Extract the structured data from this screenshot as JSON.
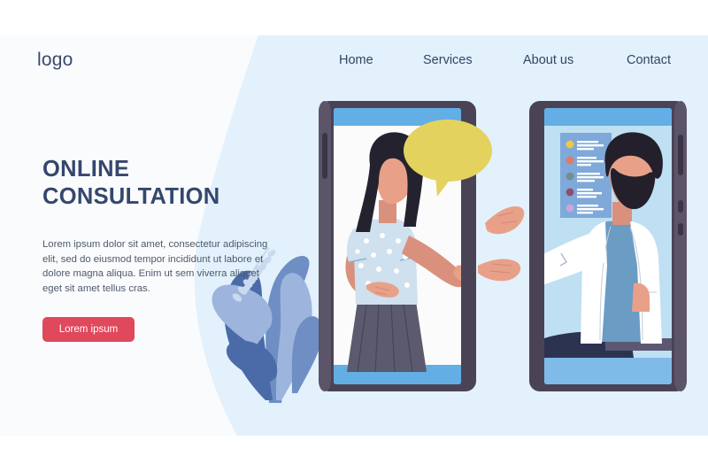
{
  "page": {
    "background": "#ffffff",
    "band_background": "#fafbfc",
    "accent_blue": "#e2f1fc",
    "brand_navy": "#35476e",
    "cta_color": "#e0485b"
  },
  "header": {
    "logo": "logo",
    "nav": [
      {
        "label": "Home"
      },
      {
        "label": "Services"
      },
      {
        "label": "About us"
      },
      {
        "label": "Contact"
      }
    ]
  },
  "hero": {
    "headline": "ONLINE CONSULTATION",
    "body": "Lorem ipsum dolor sit amet, consectetur adipiscing elit, sed do eiusmod tempor incididunt ut labore et dolore magna aliqua. Enim ut sem viverra aliquet eget sit amet tellus cras.",
    "cta_label": "Lorem ipsum"
  },
  "illustration": {
    "left_phone": {
      "frame_color": "#4a4356",
      "screen_color": "#fbfbfb",
      "status_bar_color": "#62aee5",
      "person": "patient-woman",
      "speech_bubble_color": "#e3d25e"
    },
    "right_phone": {
      "frame_color": "#4a4356",
      "screen_color": "#bfe0f2",
      "status_bar_color": "#62aee5",
      "person": "doctor-man",
      "checklist_panel_color": "#7fa9d8",
      "checklist_bullets": [
        {
          "color": "#f0c93d"
        },
        {
          "color": "#e07a66"
        },
        {
          "color": "#6f8f92"
        },
        {
          "color": "#8c4f6d"
        },
        {
          "color": "#c6a8da"
        }
      ]
    },
    "plant": {
      "leaf_dark": "#4a6ba8",
      "leaf_mid": "#6f8fc4",
      "leaf_light": "#9db5dd",
      "frond": "#c9d9ef"
    }
  }
}
